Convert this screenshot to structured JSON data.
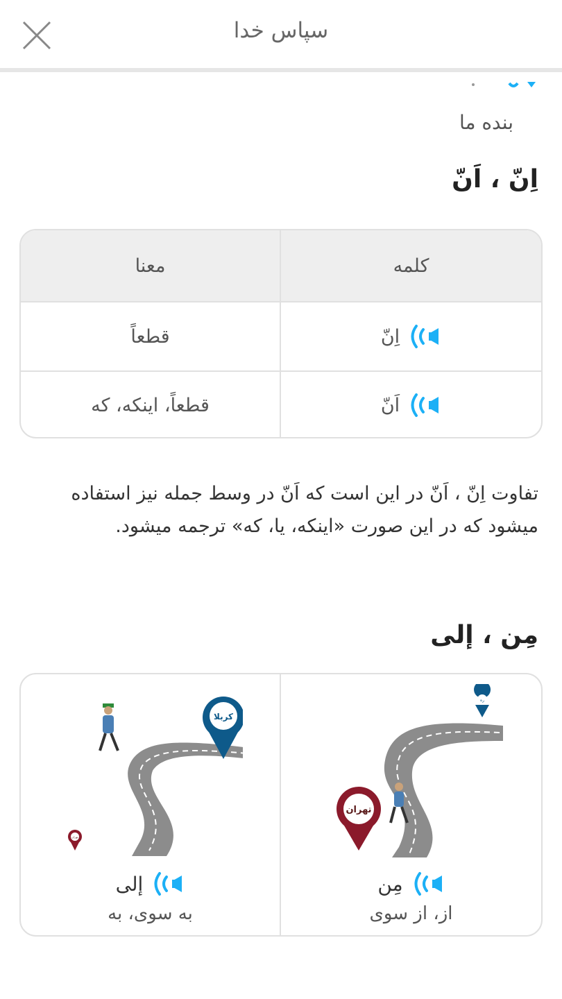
{
  "header": {
    "title": "سپاس خدا"
  },
  "previous": {
    "text": "بنده ما"
  },
  "sections": {
    "inna": {
      "title": "اِنّ ، اَنّ",
      "table": {
        "col_word": "کلمه",
        "col_meaning": "معنا",
        "rows": [
          {
            "word": "اِنّ",
            "meaning": "قطعاً"
          },
          {
            "word": "اَنّ",
            "meaning": "قطعاً، اینکه، که"
          }
        ]
      },
      "note": "تفاوت اِنّ ، اَنّ در این است که اَنّ در وسط جمله نیز استفاده میشود که در این صورت «اینکه، یا، که» ترجمه میشود."
    },
    "min": {
      "title": "مِن ، إلی",
      "cards": [
        {
          "word": "مِن",
          "meaning": "از، از سوی",
          "start_pin": "تهران",
          "end_pin": "ره"
        },
        {
          "word": "إلی",
          "meaning": "به سوی، به",
          "start_pin": "تهران",
          "end_pin": "کربلا"
        }
      ]
    }
  },
  "icons": {
    "close": "close-icon",
    "audio": "speaker-audio-icon"
  },
  "colors": {
    "audio_blue": "#1CB0F6",
    "pin_red": "#8B1A2B",
    "pin_blue": "#0E5A8A",
    "road": "#8c8c8c",
    "border": "#e0e0e0"
  }
}
